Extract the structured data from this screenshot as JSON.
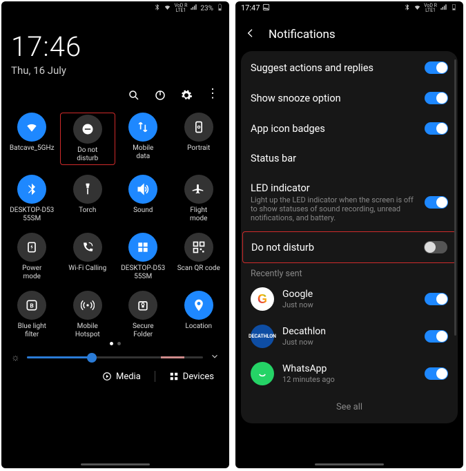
{
  "left": {
    "status": {
      "battery": "23%"
    },
    "clock": {
      "time": "17:46",
      "date": "Thu, 16 July"
    },
    "tiles": [
      {
        "label": "Batcave_5GHz",
        "icon": "wifi",
        "on": true
      },
      {
        "label": "Do not\ndisturb",
        "icon": "dnd",
        "on": false,
        "highlight": true
      },
      {
        "label": "Mobile\ndata",
        "icon": "data",
        "on": true
      },
      {
        "label": "Portrait",
        "icon": "portrait",
        "on": false
      },
      {
        "label": "DESKTOP-D53\n55SM",
        "icon": "bluetooth",
        "on": true
      },
      {
        "label": "Torch",
        "icon": "torch",
        "on": false
      },
      {
        "label": "Sound",
        "icon": "sound",
        "on": true
      },
      {
        "label": "Flight\nmode",
        "icon": "flight",
        "on": false
      },
      {
        "label": "Power\nmode",
        "icon": "power",
        "on": false
      },
      {
        "label": "Wi-Fi Calling",
        "icon": "wificall",
        "on": false
      },
      {
        "label": "DESKTOP-D53\n55SM",
        "icon": "windows",
        "on": true
      },
      {
        "label": "Scan QR code",
        "icon": "qr",
        "on": false
      },
      {
        "label": "Blue light\nfilter",
        "icon": "bluelight",
        "on": false
      },
      {
        "label": "Mobile\nHotspot",
        "icon": "hotspot",
        "on": false
      },
      {
        "label": "Secure\nFolder",
        "icon": "secure",
        "on": false
      },
      {
        "label": "Location",
        "icon": "location",
        "on": true
      }
    ],
    "footer": {
      "media": "Media",
      "devices": "Devices"
    }
  },
  "right": {
    "status": {
      "time": "17:47"
    },
    "header": "Notifications",
    "settings": [
      {
        "title": "Suggest actions and replies",
        "on": true
      },
      {
        "title": "Show snooze option",
        "on": true
      },
      {
        "title": "App icon badges",
        "on": true
      },
      {
        "title": "Status bar",
        "toggle": false
      },
      {
        "title": "LED indicator",
        "sub": "Light up the LED indicator when the screen is off to show statuses of sound recording, unread notifications, and battery.",
        "on": true
      },
      {
        "title": "Do not disturb",
        "on": false,
        "highlight": true
      }
    ],
    "recent_label": "Recently sent",
    "apps": [
      {
        "name": "Google",
        "time": "Just now",
        "bg": "#fff",
        "letter": "G",
        "color": "#4285f4"
      },
      {
        "name": "Decathlon",
        "time": "Just now",
        "bg": "#0e4da3",
        "letter": "D",
        "color": "#fff",
        "fs": "8px"
      },
      {
        "name": "WhatsApp",
        "time": "12 minutes ago",
        "bg": "#25d366",
        "letter": "✆",
        "color": "#fff"
      }
    ],
    "seeall": "See all"
  }
}
